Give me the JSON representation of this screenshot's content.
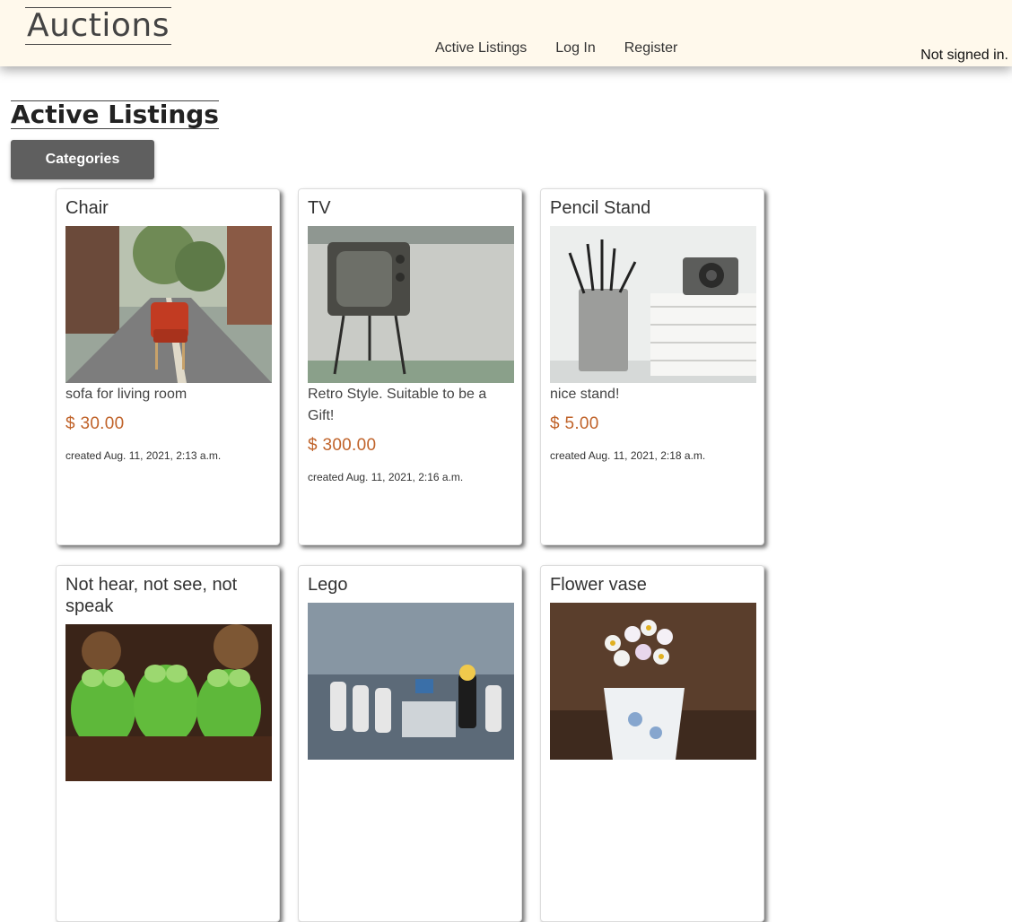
{
  "header": {
    "logo": "Auctions",
    "nav": [
      "Active Listings",
      "Log In",
      "Register"
    ],
    "status": "Not signed in."
  },
  "page": {
    "title": "Active Listings",
    "categories_button": "Categories"
  },
  "listings": [
    {
      "title": "Chair",
      "description": "sofa for living room",
      "price": "$ 30.00",
      "created": "created Aug. 11, 2021, 2:13 a.m."
    },
    {
      "title": "TV",
      "description": "Retro Style. Suitable to be a Gift!",
      "price": "$ 300.00",
      "created": "created Aug. 11, 2021, 2:16 a.m."
    },
    {
      "title": "Pencil Stand",
      "description": "nice stand!",
      "price": "$ 5.00",
      "created": "created Aug. 11, 2021, 2:18 a.m."
    },
    {
      "title": "Not hear, not see, not speak"
    },
    {
      "title": "Lego"
    },
    {
      "title": "Flower vase"
    }
  ]
}
